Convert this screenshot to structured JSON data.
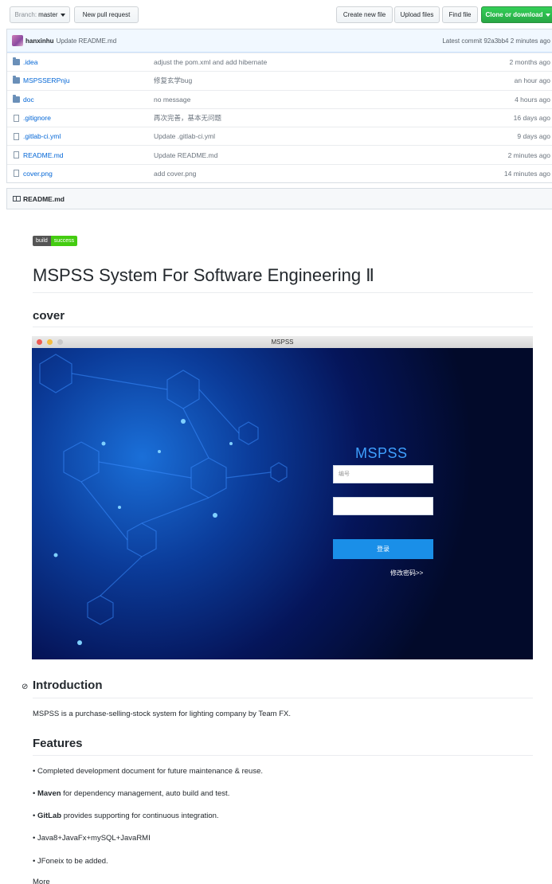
{
  "toolbar": {
    "branch_prefix": "Branch:",
    "branch_value": "master",
    "new_pull_request": "New pull request",
    "create_new_file": "Create new file",
    "upload_files": "Upload files",
    "find_file": "Find file",
    "clone_or_download": "Clone or download"
  },
  "commit": {
    "user": "hanxinhu",
    "message": "Update README.md",
    "latest_label": "Latest commit",
    "hash": "92a3bb4",
    "time": "2 minutes ago"
  },
  "files": [
    {
      "type": "folder",
      "name": ".idea",
      "message": "adjust the pom.xml and add hibernate",
      "age": "2 months ago"
    },
    {
      "type": "folder",
      "name": "MSPSSERPnju",
      "message": "修复玄学bug",
      "age": "an hour ago"
    },
    {
      "type": "folder",
      "name": "doc",
      "message": "no message",
      "age": "4 hours ago"
    },
    {
      "type": "file",
      "name": ".gitignore",
      "message": "再次完善，基本无问题",
      "age": "16 days ago"
    },
    {
      "type": "file",
      "name": ".gitlab-ci.yml",
      "message": "Update .gitlab-ci.yml",
      "age": "9 days ago"
    },
    {
      "type": "file",
      "name": "README.md",
      "message": "Update README.md",
      "age": "2 minutes ago"
    },
    {
      "type": "file",
      "name": "cover.png",
      "message": "add cover.png",
      "age": "14 minutes ago"
    }
  ],
  "readme": {
    "header": "README.md",
    "badge_left": "build",
    "badge_right": "success",
    "title": "MSPSS System For Software Engineering Ⅱ",
    "cover_heading": "cover",
    "intro_heading": "Introduction",
    "intro_text": "MSPSS is a purchase-selling-stock system for lighting company by Team FX.",
    "features_heading": "Features",
    "features": [
      {
        "bold": "",
        "text": "• Completed development document for future maintenance & reuse."
      },
      {
        "bold": "Maven",
        "text": " for dependency management, auto build and test."
      },
      {
        "bold": "GitLab",
        "text": " provides supporting for continuous integration."
      },
      {
        "bold": "",
        "text": "• Java8+JavaFx+mySQL+JavaRMI"
      },
      {
        "bold": "",
        "text": "• JFoneix to be added."
      }
    ],
    "more": "More"
  },
  "app_window": {
    "title": "MSPSS",
    "brand": "MSPSS",
    "id_placeholder": "编号",
    "login_button": "登录",
    "change_password_link": "修改密码>>"
  },
  "colors": {
    "link": "#0366d6",
    "green_button": "#28a745",
    "app_accent": "#1a8fe8"
  }
}
